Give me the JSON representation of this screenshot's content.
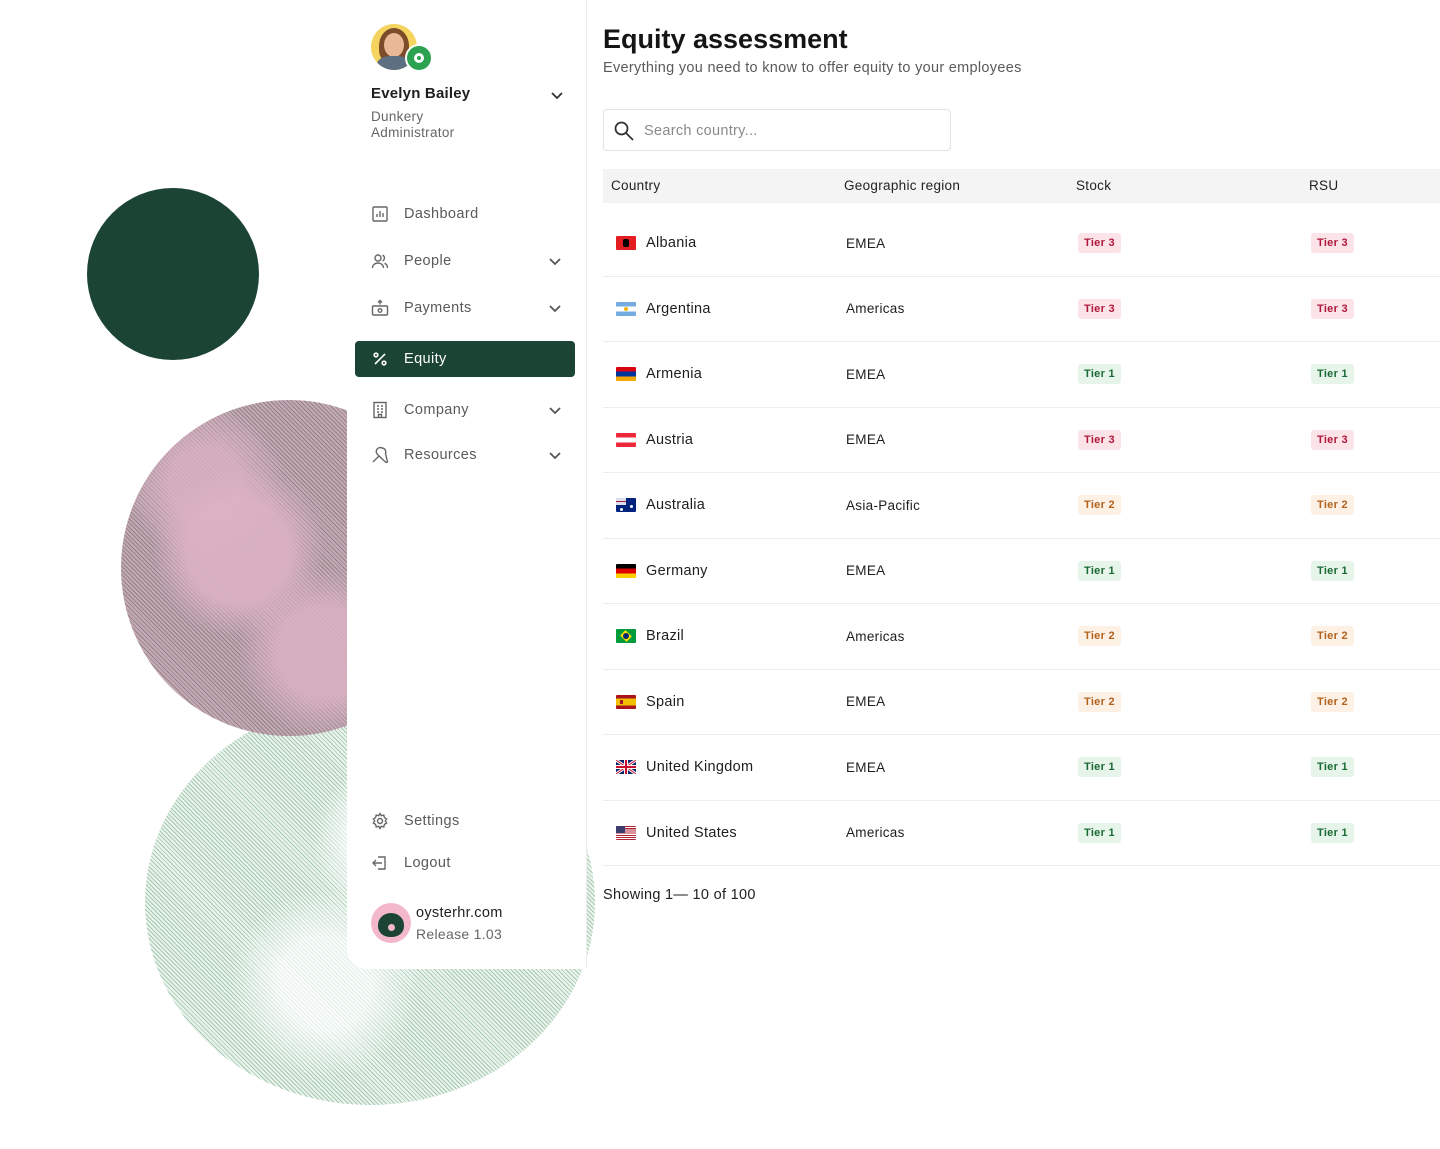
{
  "user": {
    "name": "Evelyn Bailey",
    "company": "Dunkery",
    "role": "Administrator"
  },
  "nav": {
    "items": [
      {
        "label": "Dashboard",
        "icon": "chart-icon",
        "has_chevron": false,
        "active": false
      },
      {
        "label": "People",
        "icon": "people-icon",
        "has_chevron": true,
        "active": false
      },
      {
        "label": "Payments",
        "icon": "payments-icon",
        "has_chevron": true,
        "active": false
      },
      {
        "label": "Equity",
        "icon": "percent-icon",
        "has_chevron": false,
        "active": true
      },
      {
        "label": "Company",
        "icon": "building-icon",
        "has_chevron": true,
        "active": false
      },
      {
        "label": "Resources",
        "icon": "tools-icon",
        "has_chevron": true,
        "active": false
      }
    ],
    "settings_label": "Settings",
    "logout_label": "Logout"
  },
  "brand": {
    "site": "oysterhr.com",
    "release": "Release 1.03"
  },
  "page": {
    "title": "Equity assessment",
    "subtitle": "Everything you need to know to offer equity to your employees"
  },
  "search": {
    "placeholder": "Search country..."
  },
  "table": {
    "columns": [
      "Country",
      "Geographic region",
      "Stock",
      "RSU"
    ],
    "rows": [
      {
        "country": "Albania",
        "region": "EMEA",
        "stock": "Tier 3",
        "rsu": "Tier 3",
        "flag": "albania"
      },
      {
        "country": "Argentina",
        "region": "Americas",
        "stock": "Tier 3",
        "rsu": "Tier 3",
        "flag": "argentina"
      },
      {
        "country": "Armenia",
        "region": "EMEA",
        "stock": "Tier 1",
        "rsu": "Tier 1",
        "flag": "armenia"
      },
      {
        "country": "Austria",
        "region": "EMEA",
        "stock": "Tier 3",
        "rsu": "Tier 3",
        "flag": "austria"
      },
      {
        "country": "Australia",
        "region": "Asia-Pacific",
        "stock": "Tier 2",
        "rsu": "Tier 2",
        "flag": "australia"
      },
      {
        "country": "Germany",
        "region": "EMEA",
        "stock": "Tier 1",
        "rsu": "Tier 1",
        "flag": "germany"
      },
      {
        "country": "Brazil",
        "region": "Americas",
        "stock": "Tier 2",
        "rsu": "Tier 2",
        "flag": "brazil"
      },
      {
        "country": "Spain",
        "region": "EMEA",
        "stock": "Tier 2",
        "rsu": "Tier 2",
        "flag": "spain"
      },
      {
        "country": "United Kingdom",
        "region": "EMEA",
        "stock": "Tier 1",
        "rsu": "Tier 1",
        "flag": "uk"
      },
      {
        "country": "United States",
        "region": "Americas",
        "stock": "Tier 1",
        "rsu": "Tier 1",
        "flag": "usa"
      }
    ]
  },
  "pagination": {
    "text": "Showing 1— 10 of 100"
  },
  "colors": {
    "accent": "#1c4434",
    "tier1_bg": "#e6f4ea",
    "tier1_fg": "#1a6a34",
    "tier2_bg": "#fdf1e6",
    "tier2_fg": "#b2621d",
    "tier3_bg": "#fbe3e8",
    "tier3_fg": "#b1183a"
  }
}
